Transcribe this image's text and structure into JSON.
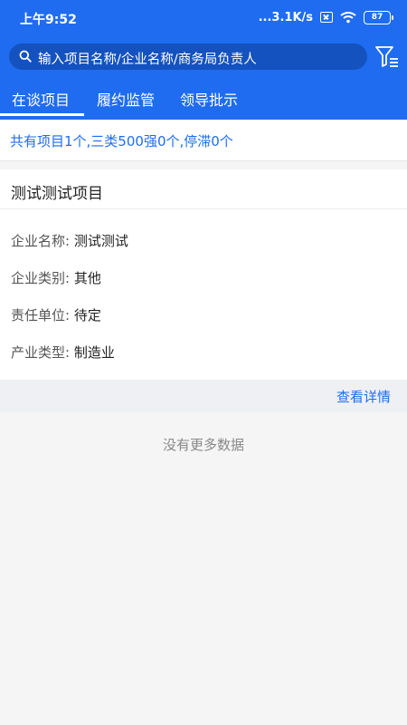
{
  "status_bar": {
    "time": "上午9:52",
    "network_speed": "...3.1K/s",
    "battery": "87"
  },
  "search": {
    "placeholder": "输入项目名称/企业名称/商务局负责人",
    "filter_icon": "filter-list-icon"
  },
  "tabs": [
    {
      "label": "在谈项目",
      "active": true
    },
    {
      "label": "履约监管",
      "active": false
    },
    {
      "label": "领导批示",
      "active": false
    }
  ],
  "summary": "共有项目1个,三类500强0个,停滞0个",
  "project_card": {
    "title": "测试测试项目",
    "fields": [
      {
        "label": "企业名称:",
        "value": "测试测试"
      },
      {
        "label": "企业类别:",
        "value": "其他"
      },
      {
        "label": "责任单位:",
        "value": "待定"
      },
      {
        "label": "产业类型:",
        "value": "制造业"
      }
    ],
    "detail_link": "查看详情"
  },
  "no_more_data": "没有更多数据",
  "colors": {
    "primary": "#1f6cf0",
    "search_bg": "#1452bf"
  }
}
